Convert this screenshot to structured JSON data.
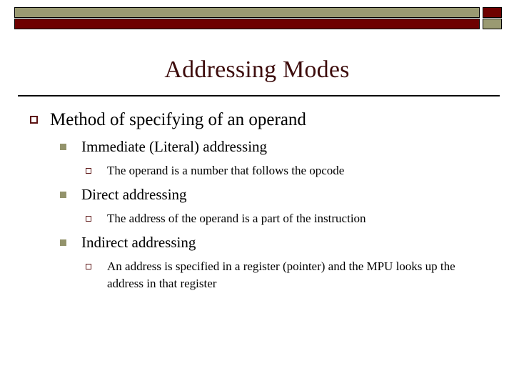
{
  "slide": {
    "title": "Addressing Modes",
    "theme": {
      "title_color": "#3d0c0c",
      "banner_tan": "#9a9a72",
      "banner_red": "#6e0000",
      "bullet_outline_color": "#5c1414",
      "bullet_fill_color": "#93936b",
      "body_text_color": "#000000",
      "background": "#ffffff"
    },
    "banner": {
      "top_bar_color": "#9a9a72",
      "top_cap_color": "#6e0000",
      "bottom_bar_color": "#6e0000",
      "bottom_cap_color": "#9a9a72"
    },
    "outline": [
      {
        "level": 1,
        "marker": "hollow-square-bullet",
        "text": "Method of specifying of an operand"
      },
      {
        "level": 2,
        "marker": "filled-square-bullet",
        "text": "Immediate (Literal) addressing"
      },
      {
        "level": 3,
        "marker": "small-hollow-square-bullet",
        "text": "The operand is a number that follows the opcode"
      },
      {
        "level": 2,
        "marker": "filled-square-bullet",
        "text": "Direct addressing"
      },
      {
        "level": 3,
        "marker": "small-hollow-square-bullet",
        "text": "The address of the operand is a part of the instruction"
      },
      {
        "level": 2,
        "marker": "filled-square-bullet",
        "text": "Indirect addressing"
      },
      {
        "level": 3,
        "marker": "small-hollow-square-bullet",
        "text": "An address is specified in a register (pointer) and the MPU looks up the address in that register"
      }
    ]
  }
}
